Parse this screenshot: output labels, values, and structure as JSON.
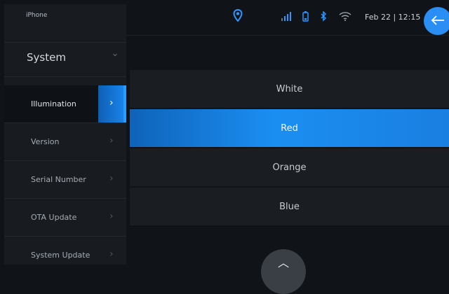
{
  "device_label": "iPhone",
  "sidebar": {
    "section": {
      "label": "System",
      "chevron_icon": "chevron-down-icon"
    },
    "items": [
      {
        "label": "Illumination",
        "active": true
      },
      {
        "label": "Version"
      },
      {
        "label": "Serial Number"
      },
      {
        "label": "OTA Update"
      },
      {
        "label": "System Update"
      }
    ]
  },
  "statusbar": {
    "icons": [
      "location-pin-icon",
      "signal-bars-icon",
      "battery-icon",
      "bluetooth-icon",
      "wifi-icon"
    ],
    "date_time": "Feb 22 | 12:15",
    "back_icon": "arrow-left-icon"
  },
  "options": [
    {
      "label": "White"
    },
    {
      "label": "Red",
      "selected": true
    },
    {
      "label": "Orange"
    },
    {
      "label": "Blue"
    }
  ],
  "colors": {
    "accent": "#1a88ee",
    "background": "#101418",
    "panel": "#181c21"
  }
}
